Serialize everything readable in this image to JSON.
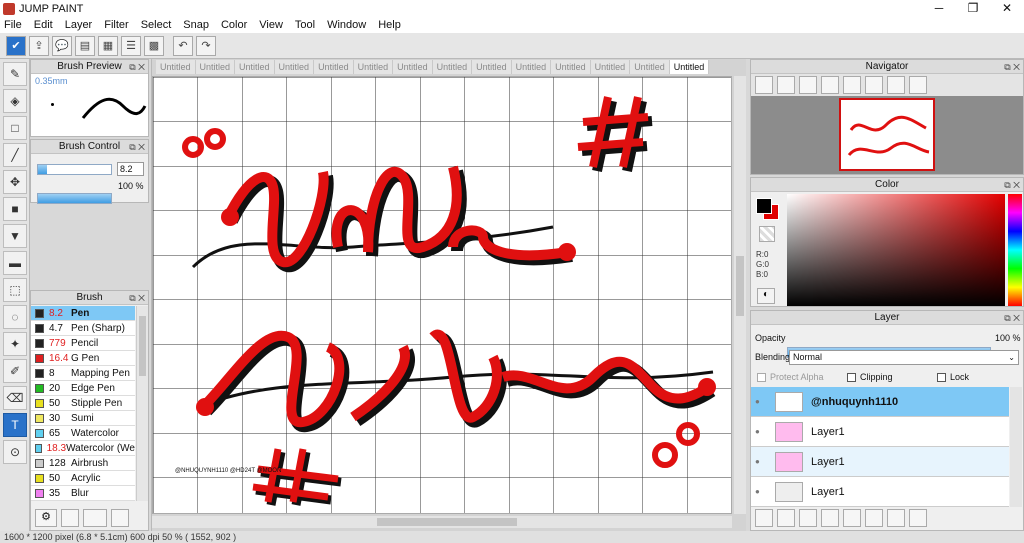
{
  "window": {
    "title": "JUMP PAINT"
  },
  "menu": [
    "File",
    "Edit",
    "Layer",
    "Filter",
    "Select",
    "Snap",
    "Color",
    "View",
    "Tool",
    "Window",
    "Help"
  ],
  "brush_preview": {
    "title": "Brush Preview",
    "size_label": "0.35mm"
  },
  "brush_control": {
    "title": "Brush Control",
    "size_value": "8.2",
    "opacity_value": "100 %"
  },
  "brush_panel": {
    "title": "Brush",
    "items": [
      {
        "size": "8.2",
        "name": "Pen",
        "color": "#222222",
        "red": true
      },
      {
        "size": "4.7",
        "name": "Pen (Sharp)",
        "color": "#222222",
        "red": false
      },
      {
        "size": "779",
        "name": "Pencil",
        "color": "#222222",
        "red": true
      },
      {
        "size": "16.4",
        "name": "G Pen",
        "color": "#e02020",
        "red": true
      },
      {
        "size": "8",
        "name": "Mapping Pen",
        "color": "#222222",
        "red": false
      },
      {
        "size": "20",
        "name": "Edge Pen",
        "color": "#22bb22",
        "red": false
      },
      {
        "size": "50",
        "name": "Stipple Pen",
        "color": "#e8e020",
        "red": false
      },
      {
        "size": "30",
        "name": "Sumi",
        "color": "#f0e860",
        "red": false
      },
      {
        "size": "65",
        "name": "Watercolor",
        "color": "#60d0f0",
        "red": false
      },
      {
        "size": "18.3",
        "name": "Watercolor (We",
        "color": "#60d0f0",
        "red": true
      },
      {
        "size": "128",
        "name": "Airbrush",
        "color": "#cccccc",
        "red": false
      },
      {
        "size": "50",
        "name": "Acrylic",
        "color": "#e8e020",
        "red": false
      },
      {
        "size": "35",
        "name": "Blur",
        "color": "#f080f0",
        "red": false
      }
    ]
  },
  "tabs": [
    "Untitled",
    "Untitled",
    "Untitled",
    "Untitled",
    "Untitled",
    "Untitled",
    "Untitled",
    "Untitled",
    "Untitled",
    "Untitled",
    "Untitled",
    "Untitled",
    "Untitled",
    "Untitled"
  ],
  "canvas_art": {
    "line1": "Vđđ",
    "line2": "Vô Thước",
    "hash": "#",
    "small": "oo",
    "watermark": "@NHUQUYNH1110 @HD24T @MOON"
  },
  "navigator": {
    "title": "Navigator"
  },
  "color_panel": {
    "title": "Color",
    "r": "R:0",
    "g": "G:0",
    "b": "B:0",
    "fg_color": "#000000",
    "bg_color": "#e00000"
  },
  "layer_panel": {
    "title": "Layer",
    "opacity_label": "Opacity",
    "opacity_value": "100 %",
    "blending_label": "Blending",
    "blending_value": "Normal",
    "protect_alpha": "Protect Alpha",
    "clipping": "Clipping",
    "lock": "Lock",
    "layers": [
      "@nhuquynh1110",
      "Layer1",
      "Layer1",
      "Layer1"
    ]
  },
  "status": {
    "text": "1600 * 1200 pixel   (6.8 * 5.1cm)   600 dpi   50 %   ( 1552, 902 )"
  }
}
